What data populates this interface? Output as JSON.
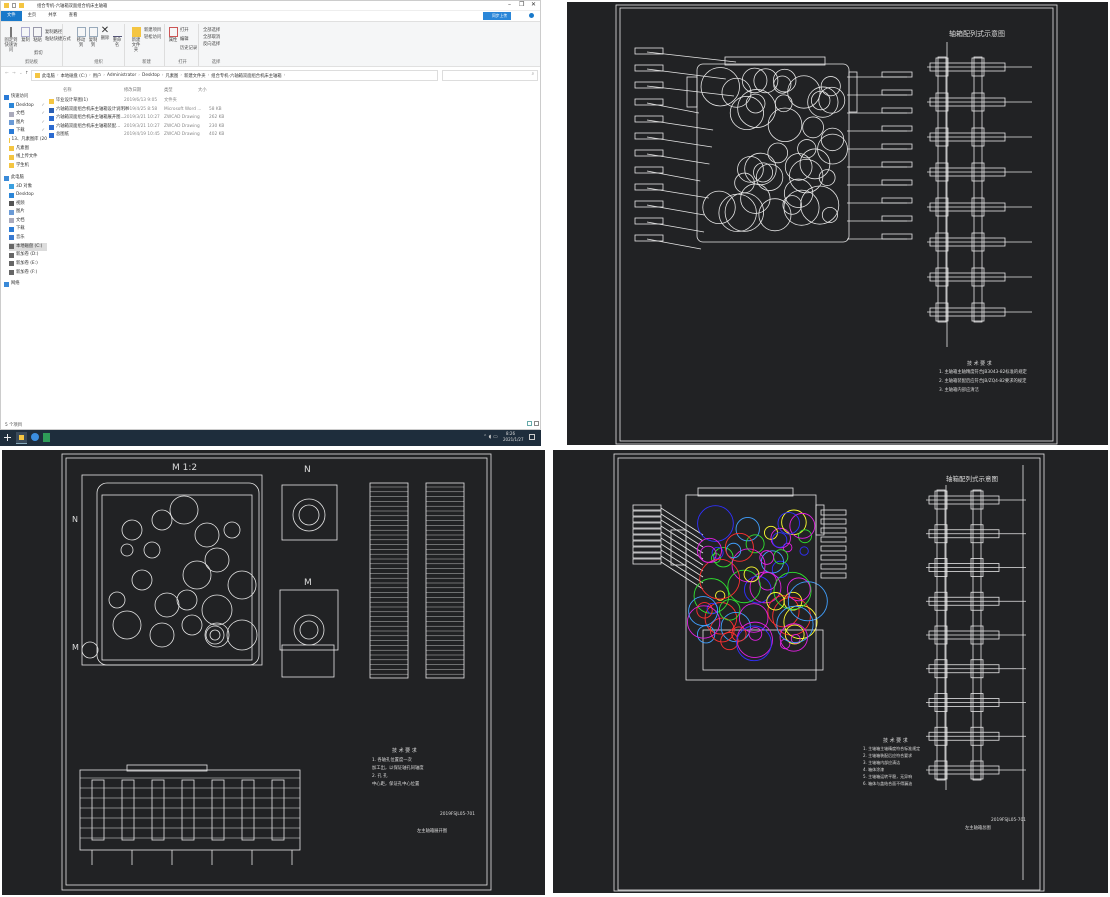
{
  "explorer": {
    "title": "组合专机-六轴箱双面组合机床主轴箱",
    "tabs": [
      "文件",
      "主页",
      "共享",
      "查看"
    ],
    "ribbon": {
      "clipboard": {
        "label": "剪贴板",
        "pin": "固定到快速访问",
        "copy": "复制",
        "paste": "粘贴",
        "copy_path": "复制路径",
        "paste_shortcut": "粘贴快捷方式",
        "cut": "剪切"
      },
      "organize": {
        "label": "组织",
        "move_to": "移动到",
        "copy_to": "复制到",
        "delete": "删除",
        "rename": "重命名"
      },
      "new": {
        "label": "新建",
        "new_folder": "新建文件夹",
        "new_item": "新建项目",
        "easy_access": "轻松访问"
      },
      "open": {
        "label": "打开",
        "properties": "属性",
        "open": "打开",
        "edit": "编辑",
        "history": "历史记录"
      },
      "select": {
        "label": "选择",
        "select_all": "全部选择",
        "select_none": "全部取消",
        "invert": "反向选择"
      }
    },
    "cloud_button": "同步上传",
    "breadcrumb": [
      "此电脑",
      "本地磁盘 (C:)",
      "用户",
      "Administrator",
      "Desktop",
      "凡素图",
      "新建文件夹",
      "组合专机-六轴箱双面组合机床主轴箱"
    ],
    "columns": [
      "名称",
      "修改日期",
      "类型",
      "大小"
    ],
    "files": [
      {
        "name": "毕业设计草图(1)",
        "date": "2019/6/13 9:05",
        "type": "文件夹",
        "size": "",
        "icon": "folder"
      },
      {
        "name": "六轴箱双面组合机床主轴箱设计说明书",
        "date": "2019/4/25 8:58",
        "type": "Microsoft Word ...",
        "size": "58 KB",
        "icon": "word"
      },
      {
        "name": "六轴箱双面组合机床主轴箱展开图...",
        "date": "2019/3/21 10:27",
        "type": "ZWCAD Drawing",
        "size": "262 KB",
        "icon": "cad"
      },
      {
        "name": "六轴箱双面组合机床主轴箱装配...",
        "date": "2019/3/21 10:27",
        "type": "ZWCAD Drawing",
        "size": "230 KB",
        "icon": "cad"
      },
      {
        "name": "总图纸",
        "date": "2019/4/19 10:45",
        "type": "ZWCAD Drawing",
        "size": "402 KB",
        "icon": "cad"
      }
    ],
    "nav": [
      {
        "label": "快速访问",
        "icon": "star"
      },
      {
        "label": "Desktop",
        "icon": "desktop",
        "pin": true
      },
      {
        "label": "文档",
        "icon": "doc",
        "pin": true
      },
      {
        "label": "图片",
        "icon": "pic",
        "pin": true
      },
      {
        "label": "下载",
        "icon": "download",
        "pin": true
      },
      {
        "label": "13、凡素图库 (20",
        "icon": "folder"
      },
      {
        "label": "凡素图",
        "icon": "folder"
      },
      {
        "label": "线上传文件",
        "icon": "folder"
      },
      {
        "label": "学生机",
        "icon": "folder"
      },
      {
        "label": "此电脑",
        "icon": "pc"
      },
      {
        "label": "3D 对象",
        "icon": "3d"
      },
      {
        "label": "Desktop",
        "icon": "desktop"
      },
      {
        "label": "视频",
        "icon": "video"
      },
      {
        "label": "图片",
        "icon": "pic"
      },
      {
        "label": "文档",
        "icon": "doc"
      },
      {
        "label": "下载",
        "icon": "download"
      },
      {
        "label": "音乐",
        "icon": "music"
      },
      {
        "label": "本地磁盘 (C:)",
        "icon": "drive",
        "selected": true
      },
      {
        "label": "新加卷 (D:)",
        "icon": "drive"
      },
      {
        "label": "新加卷 (E:)",
        "icon": "drive"
      },
      {
        "label": "新加卷 (F:)",
        "icon": "drive"
      },
      {
        "label": "网络",
        "icon": "network"
      }
    ],
    "status": "5 个项目",
    "taskbar": {
      "time": "8:26",
      "date": "2021/1/27"
    }
  },
  "drawings": {
    "top_right": {
      "diagram_title": "轴箱配列式示意图",
      "tech_title": "技 术 要 求",
      "notes": [
        "1. 主轴箱主轴精度符合JB3043-82标准的规定",
        "2. 主轴箱装配后应符合JB/ZQ4-82要求的规定",
        "3. 主轴箱内部应清洁"
      ]
    },
    "bottom_left": {
      "scale_label": "M 1:2",
      "view_n": "N",
      "view_m": "M",
      "mark_n": "N",
      "mark_m": "M",
      "tech_title": "技 术 要 求",
      "notes": [
        "1. 各轴孔位置度一次",
        "   加工出，以保证轴孔同轴度",
        "2. 孔       孔",
        "   中心距，保证孔中心位置"
      ],
      "drawing_no": "2019FSJL05-701",
      "drawing_name": "左主轴箱展开图"
    },
    "bottom_right": {
      "diagram_title": "轴箱配列式示意图",
      "tech_title": "技 术 要 求",
      "notes": [
        "1. 主轴箱主轴精度符合标准规定",
        "2. 主轴箱装配后应符合要求",
        "3. 主轴箱内部应清洁",
        "4. 箱体涂漆",
        "5. 主轴箱运转平稳，无异响",
        "6. 箱体与盖结合面不得漏油"
      ],
      "drawing_no": "2019FSJL05-701",
      "drawing_name": "左主轴箱总图"
    }
  },
  "colors": {
    "cad_bg": "#212224",
    "cad_line": "#e8e8e8",
    "accent": "#1979ca",
    "taskbar": "#1e2d3c"
  }
}
